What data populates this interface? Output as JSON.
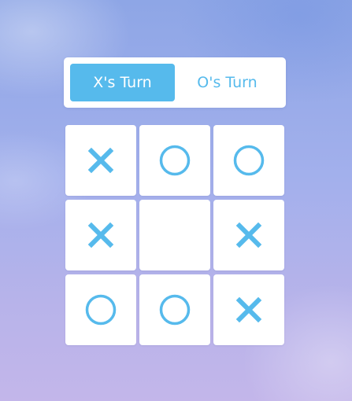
{
  "turn_bar": {
    "x_label": "X's Turn",
    "o_label": "O's Turn",
    "active": "X"
  },
  "board": {
    "cells": [
      "X",
      "O",
      "O",
      "X",
      "",
      "X",
      "O",
      "O",
      "X"
    ]
  },
  "colors": {
    "accent": "#56baec",
    "tile": "#ffffff"
  },
  "icons": {
    "X": "x-mark-icon",
    "O": "o-mark-icon"
  }
}
